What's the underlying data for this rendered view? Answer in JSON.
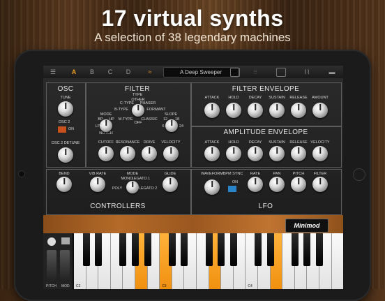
{
  "hero": {
    "title": "17 virtual synths",
    "subtitle": "A selection of 38 legendary machines"
  },
  "topbar": {
    "slots": [
      "A",
      "B",
      "C",
      "D"
    ],
    "active_slot": "A",
    "preset": "A Deep Sweeper"
  },
  "osc": {
    "title": "OSC",
    "tune": "TUNE",
    "osc2": "OSC 2",
    "on": "ON",
    "detune": "OSC 2 DETUNE"
  },
  "filter": {
    "title": "FILTER",
    "type": "TYPE",
    "type_opts": [
      "OTHER",
      "C-TYPE",
      "PHASER",
      "B-TYPE",
      "FORMANT",
      "M-TYPE",
      "CLASSIC",
      "OFF"
    ],
    "mode": "MODE",
    "mode_opts": [
      "BP",
      "HP",
      "LP",
      "NOTCH"
    ],
    "slope": "SLOPE",
    "slope_opts": [
      "12",
      "18",
      "24",
      "6"
    ],
    "knobs": [
      "CUTOFF",
      "RESONANCE",
      "DRIVE",
      "VELOCITY"
    ]
  },
  "filter_env": {
    "title": "FILTER ENVELOPE",
    "knobs": [
      "ATTACK",
      "HOLD",
      "DECAY",
      "SUSTAIN",
      "RELEASE",
      "AMOUNT"
    ]
  },
  "amp_env": {
    "title": "AMPLITUDE ENVELOPE",
    "knobs": [
      "ATTACK",
      "HOLD",
      "DECAY",
      "SUSTAIN",
      "RELEASE",
      "VELOCITY"
    ]
  },
  "controllers": {
    "title": "CONTROLLERS",
    "bend": "BEND",
    "vib": "VIB RATE",
    "mode": "MODE",
    "mode_opts": [
      "MONO",
      "LEGATO 1",
      "POLY",
      "LEGATO 2"
    ],
    "glide": "GLIDE"
  },
  "lfo": {
    "title": "LFO",
    "waveform": "WAVEFORM",
    "bpm": "BPM SYNC",
    "on": "ON",
    "knobs": [
      "RATE",
      "PAN",
      "PITCH",
      "FILTER"
    ]
  },
  "brand": "Minimod",
  "keyboard": {
    "pitch": "PITCH",
    "mod": "MOD",
    "octaves": [
      "C2",
      "C3",
      "C4"
    ]
  }
}
